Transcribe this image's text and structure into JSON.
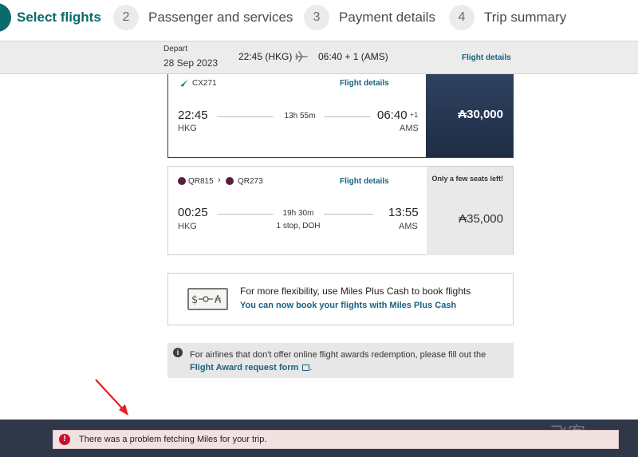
{
  "stepper": {
    "steps": [
      {
        "number": "1",
        "label": "Select flights"
      },
      {
        "number": "2",
        "label": "Passenger and services"
      },
      {
        "number": "3",
        "label": "Payment details"
      },
      {
        "number": "4",
        "label": "Trip summary"
      }
    ]
  },
  "summary_bar": {
    "depart_label": "Depart",
    "date": "28 Sep 2023",
    "departure": "22:45 (HKG)",
    "arrival": "06:40 + 1 (AMS)",
    "details_link": "Flight details"
  },
  "flights": [
    {
      "codes": [
        "CX271"
      ],
      "details_link": "Flight details",
      "dep_time": "22:45",
      "dep_port": "HKG",
      "duration": "13h 55m",
      "stops": "",
      "arr_time": "06:40",
      "arr_offset": "+1",
      "arr_port": "AMS",
      "price": "30,000",
      "seats_note": "",
      "selected": true
    },
    {
      "codes": [
        "QR815",
        "QR273"
      ],
      "details_link": "Flight details",
      "dep_time": "00:25",
      "dep_port": "HKG",
      "duration": "19h 30m",
      "stops": "1 stop, DOH",
      "arr_time": "13:55",
      "arr_offset": "",
      "arr_port": "AMS",
      "price": "35,000",
      "seats_note": "Only a few seats left!",
      "selected": false
    }
  ],
  "miles_plus_cash": {
    "title": "For more flexibility, use Miles Plus Cash to book flights",
    "link": "You can now book your flights with Miles Plus Cash"
  },
  "info_notice": {
    "text": "For airlines that don't offer online flight awards redemption, please fill out the",
    "link": "Flight Award request form"
  },
  "error_toast": {
    "message": "There was a problem fetching Miles for your trip."
  },
  "watermark": {
    "brand": "FLYERT",
    "sub": "飞客"
  },
  "colors": {
    "brand_teal": "#0b6b6a",
    "link_blue": "#1a6280",
    "selected_price_bg": "#2f4261",
    "error_red": "#c8102e",
    "footer_bg": "#2e3849"
  }
}
